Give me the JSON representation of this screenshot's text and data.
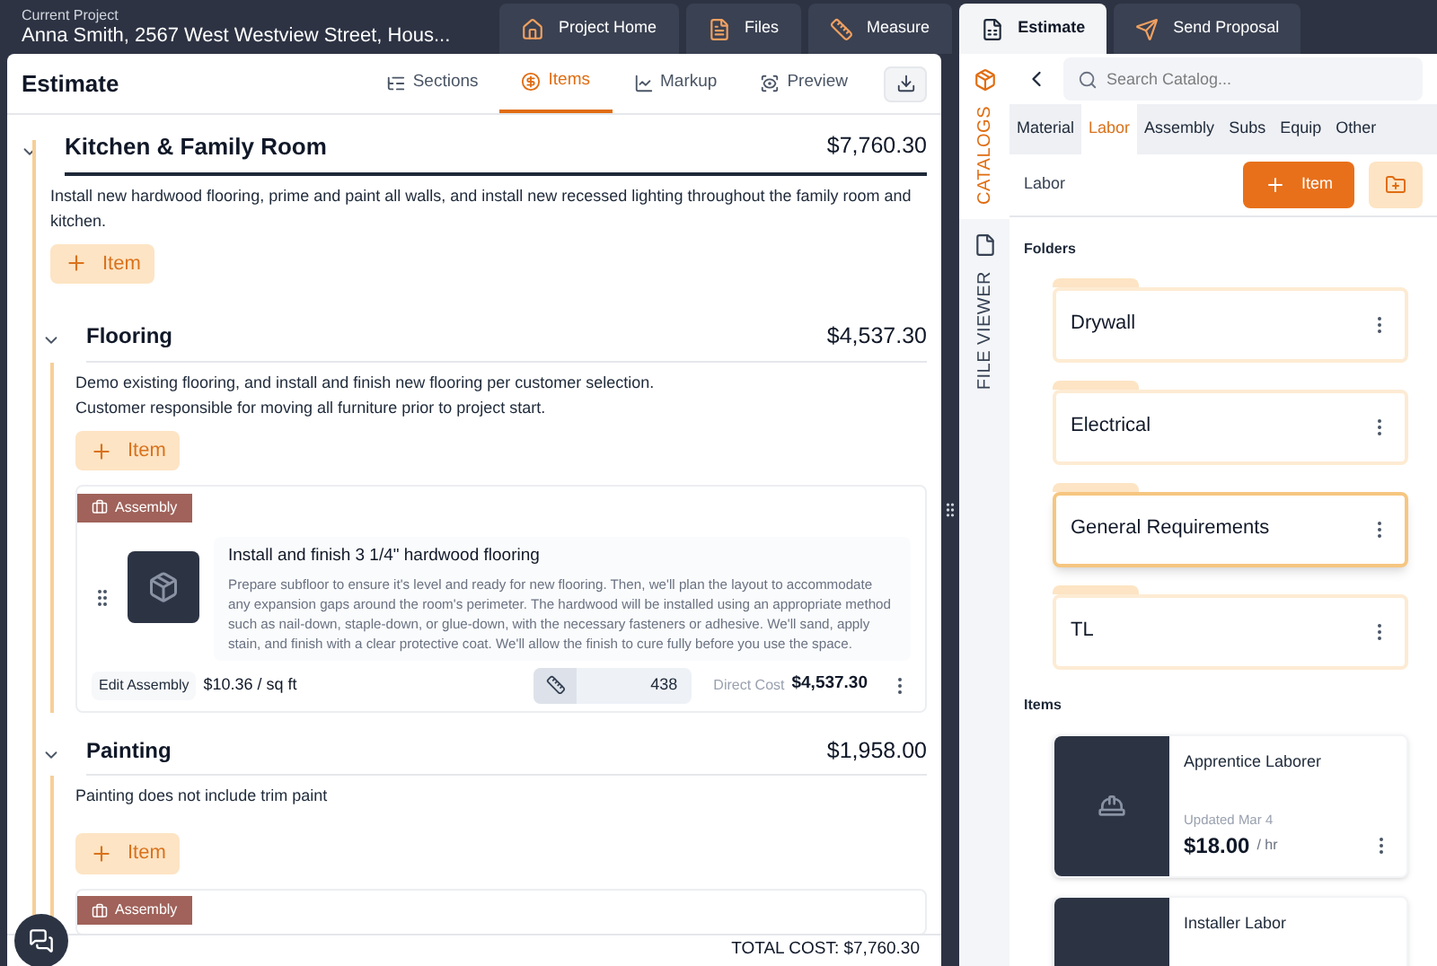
{
  "project": {
    "label": "Current Project",
    "name": "Anna Smith, 2567 West Westview Street, Hous..."
  },
  "nav": [
    {
      "label": "Project Home",
      "kind": "home",
      "selected": false
    },
    {
      "label": "Files",
      "kind": "file",
      "selected": false
    },
    {
      "label": "Measure",
      "kind": "ruler",
      "selected": false
    },
    {
      "label": "Estimate",
      "kind": "estimate",
      "selected": true
    },
    {
      "label": "Send Proposal",
      "kind": "send",
      "selected": false
    }
  ],
  "estimate": {
    "title": "Estimate",
    "tabs": [
      {
        "label": "Sections",
        "kind": "sections",
        "selected": false
      },
      {
        "label": "Items",
        "kind": "items",
        "selected": true
      },
      {
        "label": "Markup",
        "kind": "markup",
        "selected": false
      },
      {
        "label": "Preview",
        "kind": "preview",
        "selected": false
      }
    ],
    "sections": [
      {
        "name": "Kitchen & Family Room",
        "total": "$7,760.30",
        "expanded": true,
        "top": true,
        "description": "Install new hardwood flooring, prime and paint all walls, and install new recessed lighting throughout the family room and kitchen.",
        "add_label": "Item"
      },
      {
        "name": "Flooring",
        "total": "$4,537.30",
        "expanded": true,
        "top": false,
        "description": "Demo existing flooring, and install and finish new flooring per customer selection.\nCustomer responsible for moving all furniture prior to project start.",
        "add_label": "Item",
        "items": [
          {
            "badge": "Assembly",
            "title": "Install and finish 3 1/4\" hardwood flooring",
            "description": "Prepare subfloor to ensure it's level and ready for new flooring. Then, we'll plan the layout to accommodate any expansion gaps around the room's perimeter. The hardwood will be installed using an appropriate method such as nail-down, staple-down, or glue-down, with the necessary fasteners or adhesive. We'll sand, apply stain, and finish with a clear protective coat. We'll allow the finish to cure fully before you use the space.",
            "edit_label": "Edit Assembly",
            "unit_price": "$10.36 / sq ft",
            "quantity": "438",
            "cost_label": "Direct Cost",
            "cost": "$4,537.30"
          }
        ]
      },
      {
        "name": "Painting",
        "total": "$1,958.00",
        "expanded": true,
        "top": false,
        "description": "Painting does not include trim paint",
        "add_label": "Item",
        "items": [
          {
            "badge": "Assembly"
          }
        ]
      }
    ],
    "total": "TOTAL COST: $7,760.30"
  },
  "side_tabs": [
    {
      "label": "CATALOGS",
      "kind": "catalog",
      "selected": true
    },
    {
      "label": "FILE VIEWER",
      "kind": "file",
      "selected": false
    }
  ],
  "catalog": {
    "search_placeholder": "Search Catalog...",
    "tabs": [
      {
        "label": "Material",
        "selected": false
      },
      {
        "label": "Labor",
        "selected": true
      },
      {
        "label": "Assembly",
        "selected": false
      },
      {
        "label": "Subs",
        "selected": false
      },
      {
        "label": "Equip",
        "selected": false
      },
      {
        "label": "Other",
        "selected": false
      }
    ],
    "breadcrumb": "Labor",
    "add_label": "Item",
    "folders_heading": "Folders",
    "folders": [
      {
        "name": "Drywall",
        "selected": false
      },
      {
        "name": "Electrical",
        "selected": false
      },
      {
        "name": "General Requirements",
        "selected": true
      },
      {
        "name": "TL",
        "selected": false
      }
    ],
    "items_heading": "Items",
    "items": [
      {
        "name": "Apprentice Laborer",
        "updated": "Updated Mar 4",
        "price": "$18.00",
        "unit": "/ hr"
      },
      {
        "name": "Installer Labor"
      }
    ]
  }
}
